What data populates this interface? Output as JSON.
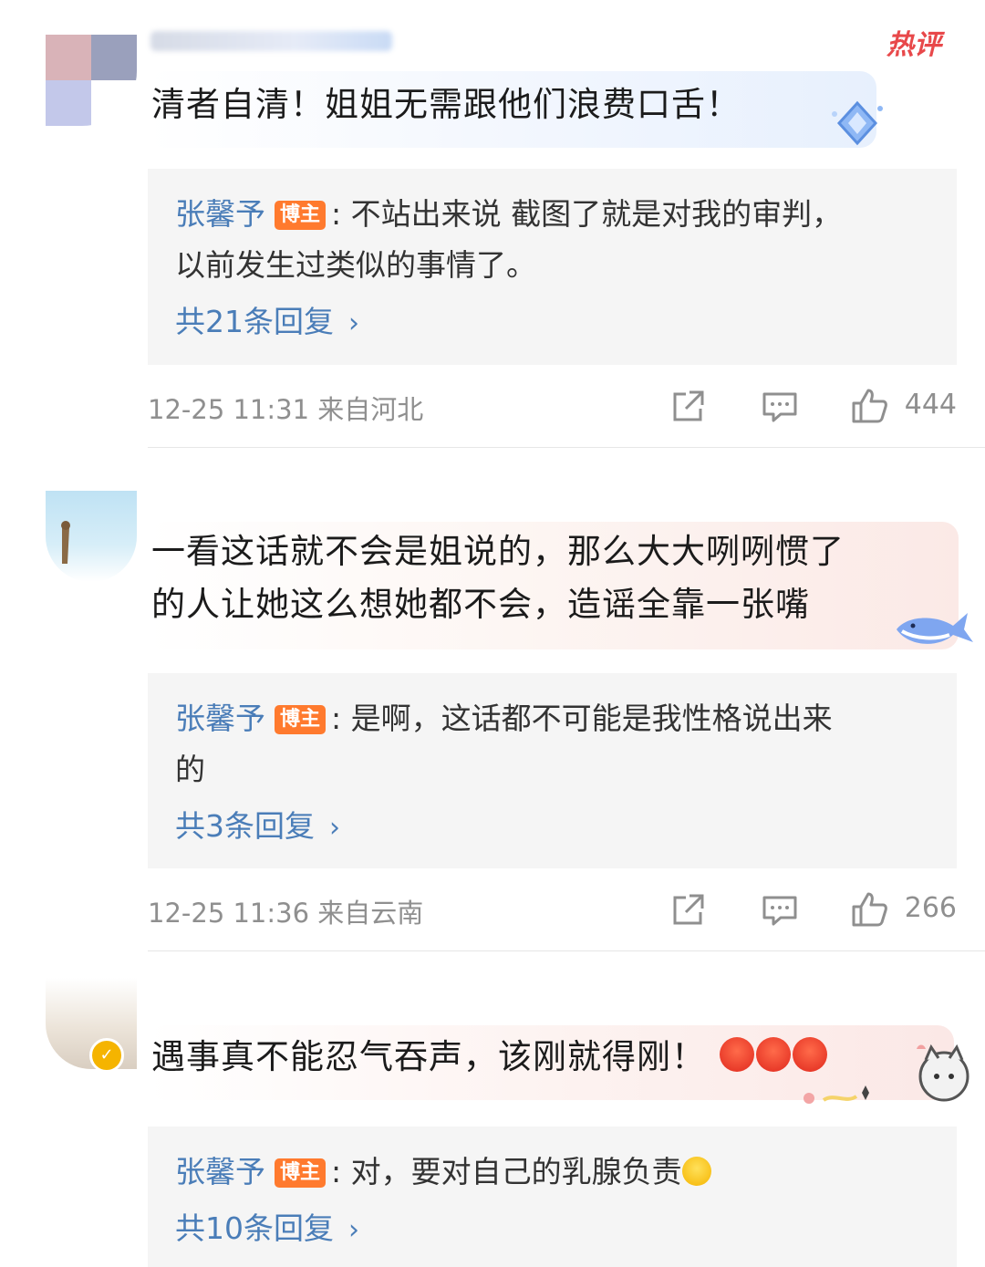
{
  "hot_label": "热评",
  "comments": [
    {
      "text": "清者自清！姐姐无需跟他们浪费口舌！",
      "reply": {
        "author": "张馨予",
        "tag": "博主",
        "text": ": 不站出来说 截图了就是对我的审判，",
        "text2": "以前发生过类似的事情了。"
      },
      "reply_count": "共21条回复",
      "meta": "12-25 11:31  来自河北",
      "likes": "444"
    },
    {
      "text_line1": "一看这话就不会是姐说的，那么大大咧咧惯了",
      "text_line2": "的人让她这么想她都不会，造谣全靠一张嘴",
      "reply": {
        "author": "张馨予",
        "tag": "博主",
        "text": ": 是啊，这话都不可能是我性格说出来",
        "text2": "的"
      },
      "reply_count": "共3条回复",
      "meta": "12-25 11:36  来自云南",
      "likes": "266"
    },
    {
      "text": "遇事真不能忍气吞声，该刚就得刚！",
      "reply": {
        "author": "张馨予",
        "tag": "博主",
        "text": ": 对，要对自己的乳腺负责"
      },
      "reply_count": "共10条回复"
    }
  ],
  "icons": {
    "share": "share-icon",
    "comment": "comment-icon",
    "like": "thumbs-up-icon",
    "chevron": "chevron-right-icon",
    "verified": "verified-badge-icon"
  },
  "colors": {
    "link_blue": "#4a7db8",
    "blogger_tag": "#ff7a2e",
    "hot_red": "#e8484a",
    "meta_gray": "#8f8f8f",
    "reply_bg": "#f5f5f5"
  }
}
